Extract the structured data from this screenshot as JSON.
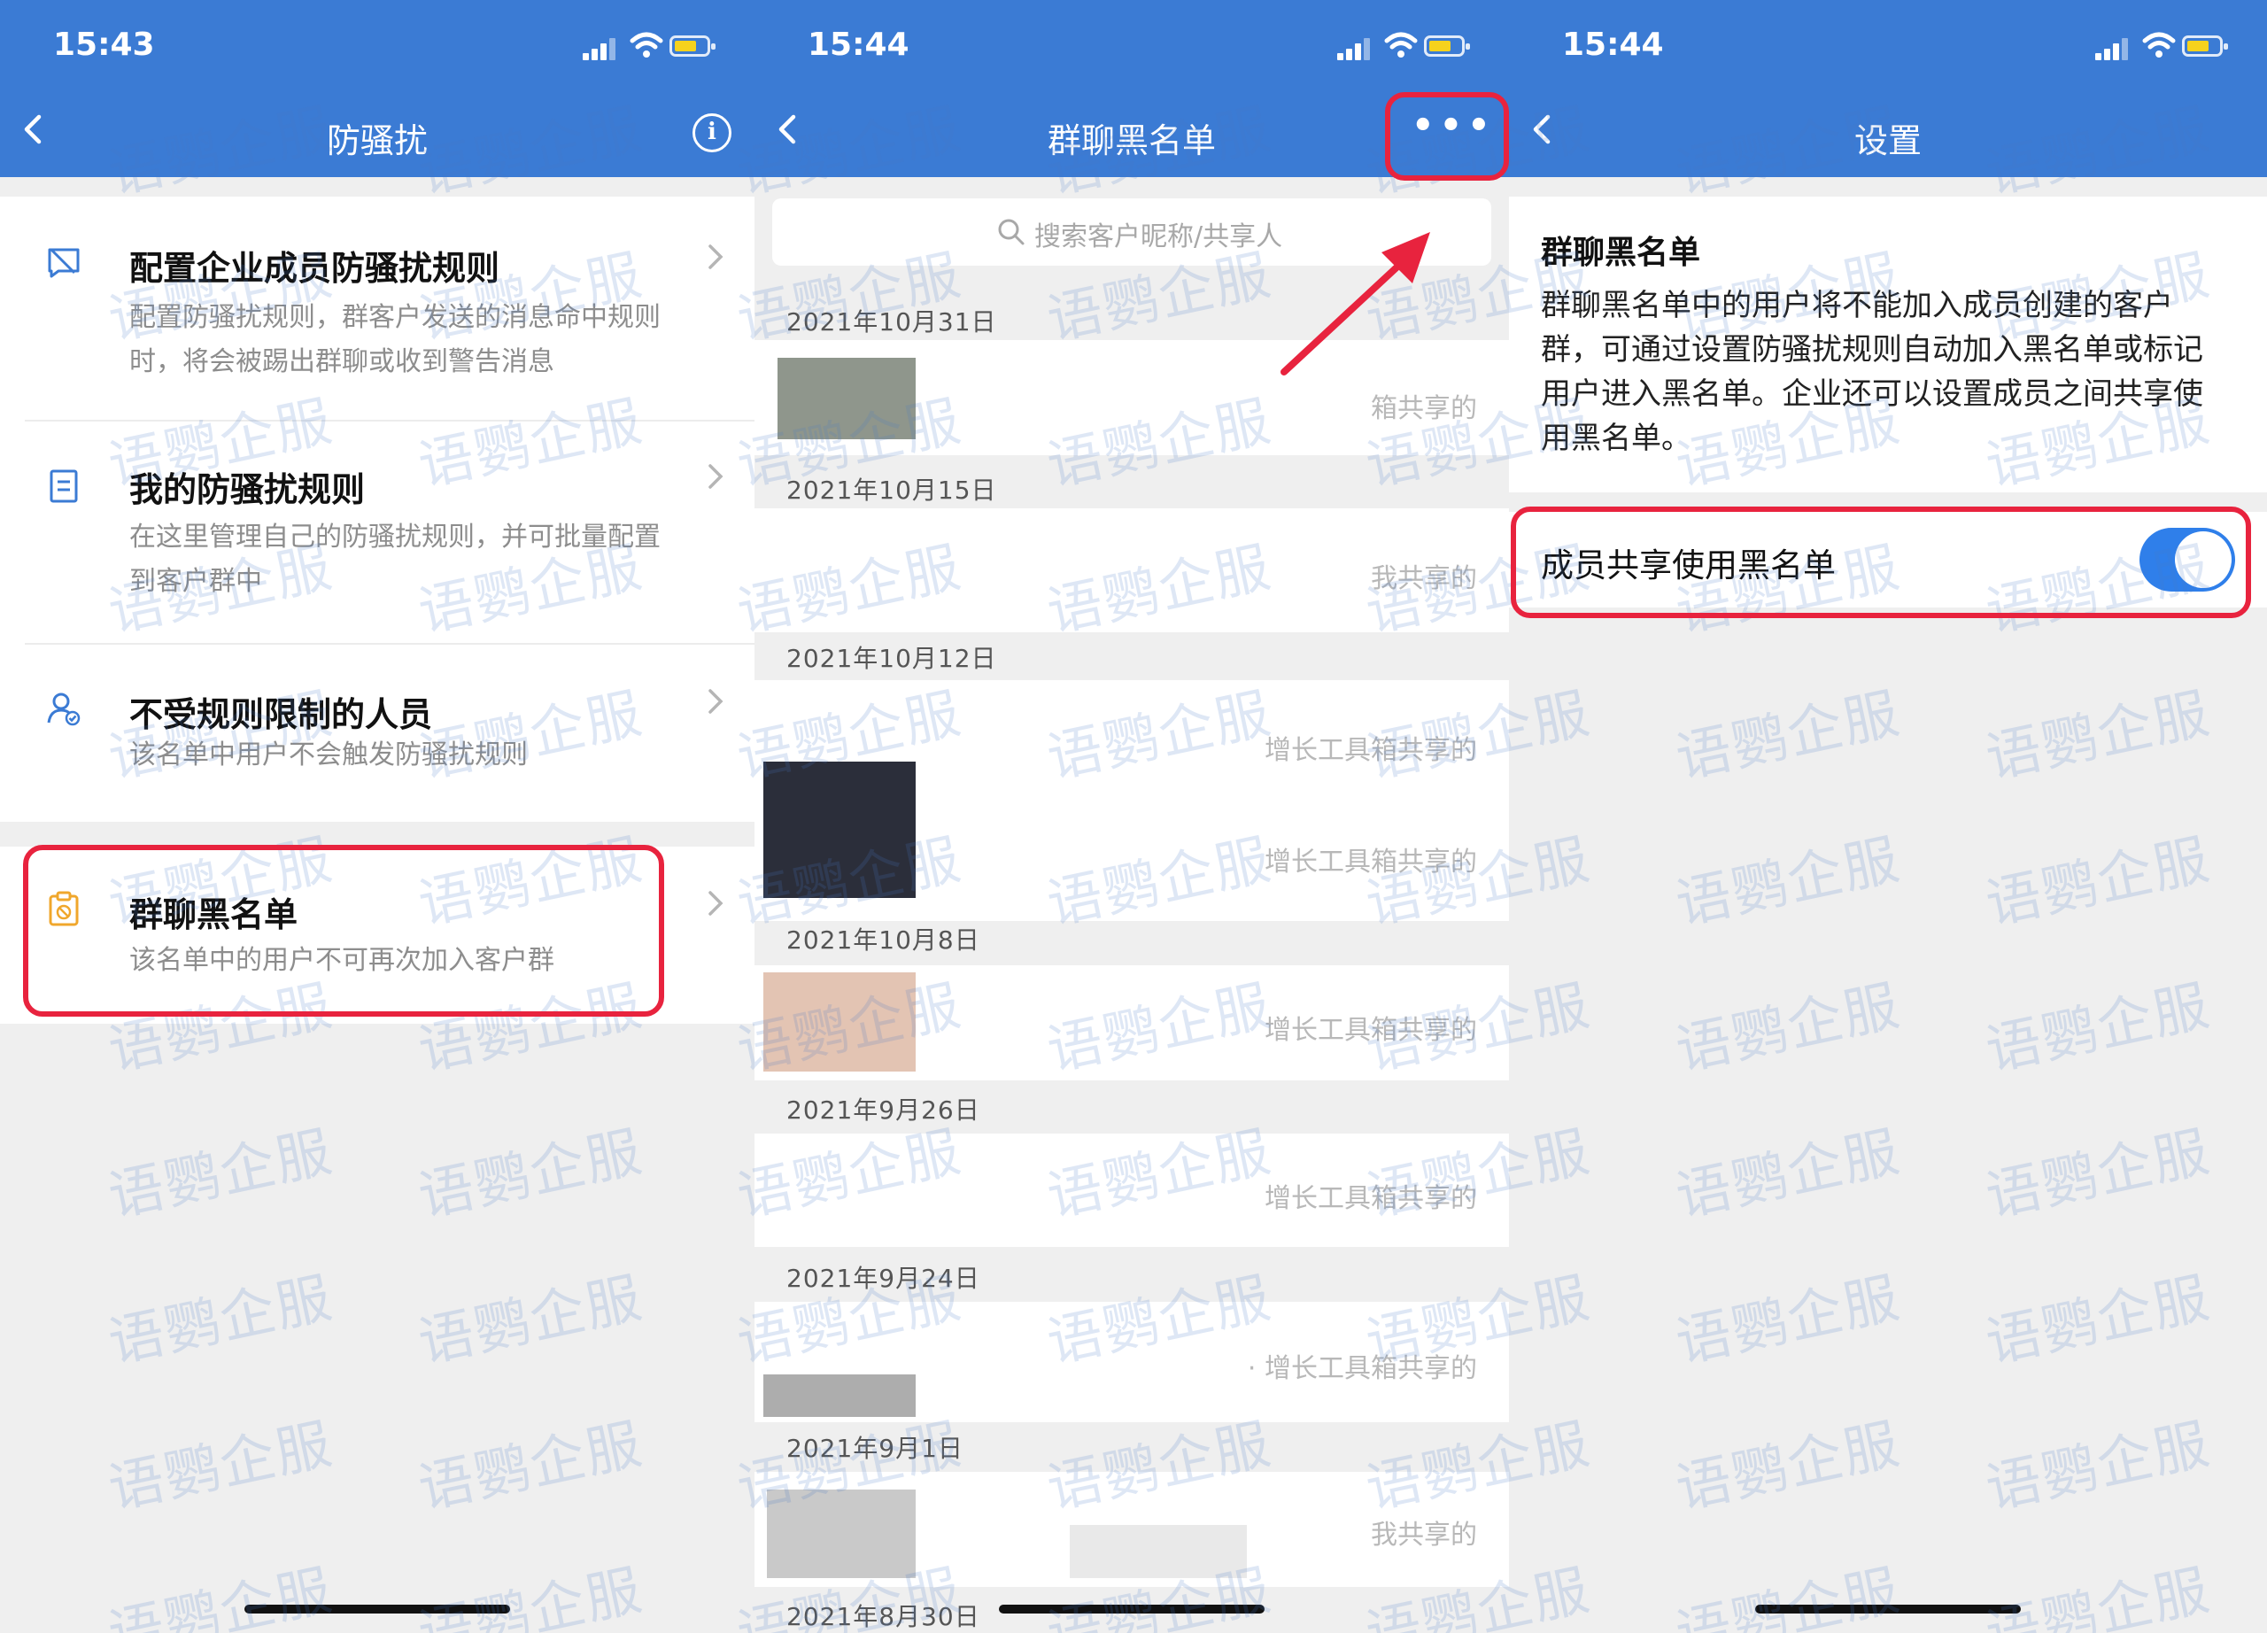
{
  "screen1": {
    "time": "15:43",
    "title": "防骚扰",
    "items": [
      {
        "title": "配置企业成员防骚扰规则",
        "desc": "配置防骚扰规则，群客户发送的消息命中规则时，将会被踢出群聊或收到警告消息",
        "icon": "no-message-icon"
      },
      {
        "title": "我的防骚扰规则",
        "desc": "在这里管理自己的防骚扰规则，并可批量配置到客户群中",
        "icon": "clipboard-list-icon"
      },
      {
        "title": "不受规则限制的人员",
        "desc": "该名单中用户不会触发防骚扰规则",
        "icon": "user-check-icon"
      },
      {
        "title": "群聊黑名单",
        "desc": "该名单中的用户不可再次加入客户群",
        "icon": "blocked-clipboard-icon"
      }
    ]
  },
  "screen2": {
    "time": "15:44",
    "title": "群聊黑名单",
    "search_placeholder": "搜索客户昵称/共享人",
    "groups": [
      {
        "date": "2021年10月31日",
        "rows": [
          {
            "share": "箱共享的"
          }
        ]
      },
      {
        "date": "2021年10月15日",
        "rows": [
          {
            "share": "我共享的"
          }
        ]
      },
      {
        "date": "2021年10月12日",
        "rows": [
          {
            "share": "增长工具箱共享的"
          },
          {
            "share": "增长工具箱共享的"
          }
        ]
      },
      {
        "date": "2021年10月8日",
        "rows": [
          {
            "share": "增长工具箱共享的"
          }
        ]
      },
      {
        "date": "2021年9月26日",
        "rows": [
          {
            "share": "增长工具箱共享的"
          }
        ]
      },
      {
        "date": "2021年9月24日",
        "rows": [
          {
            "share": "· 增长工具箱共享的"
          }
        ]
      },
      {
        "date": "2021年9月1日",
        "rows": [
          {
            "share": "我共享的"
          }
        ]
      },
      {
        "date": "2021年8月30日",
        "rows": []
      }
    ]
  },
  "screen3": {
    "time": "15:44",
    "title": "设置",
    "section_title": "群聊黑名单",
    "description": "群聊黑名单中的用户将不能加入成员创建的客户群，可通过设置防骚扰规则自动加入黑名单或标记用户进入黑名单。企业还可以设置成员之间共享使用黑名单。",
    "toggle_label": "成员共享使用黑名单",
    "toggle_on": true
  },
  "watermark": "语鹦企服",
  "colors": {
    "nav": "#3b7bd4",
    "highlight": "#e8233e",
    "toggle": "#2f7fea"
  }
}
